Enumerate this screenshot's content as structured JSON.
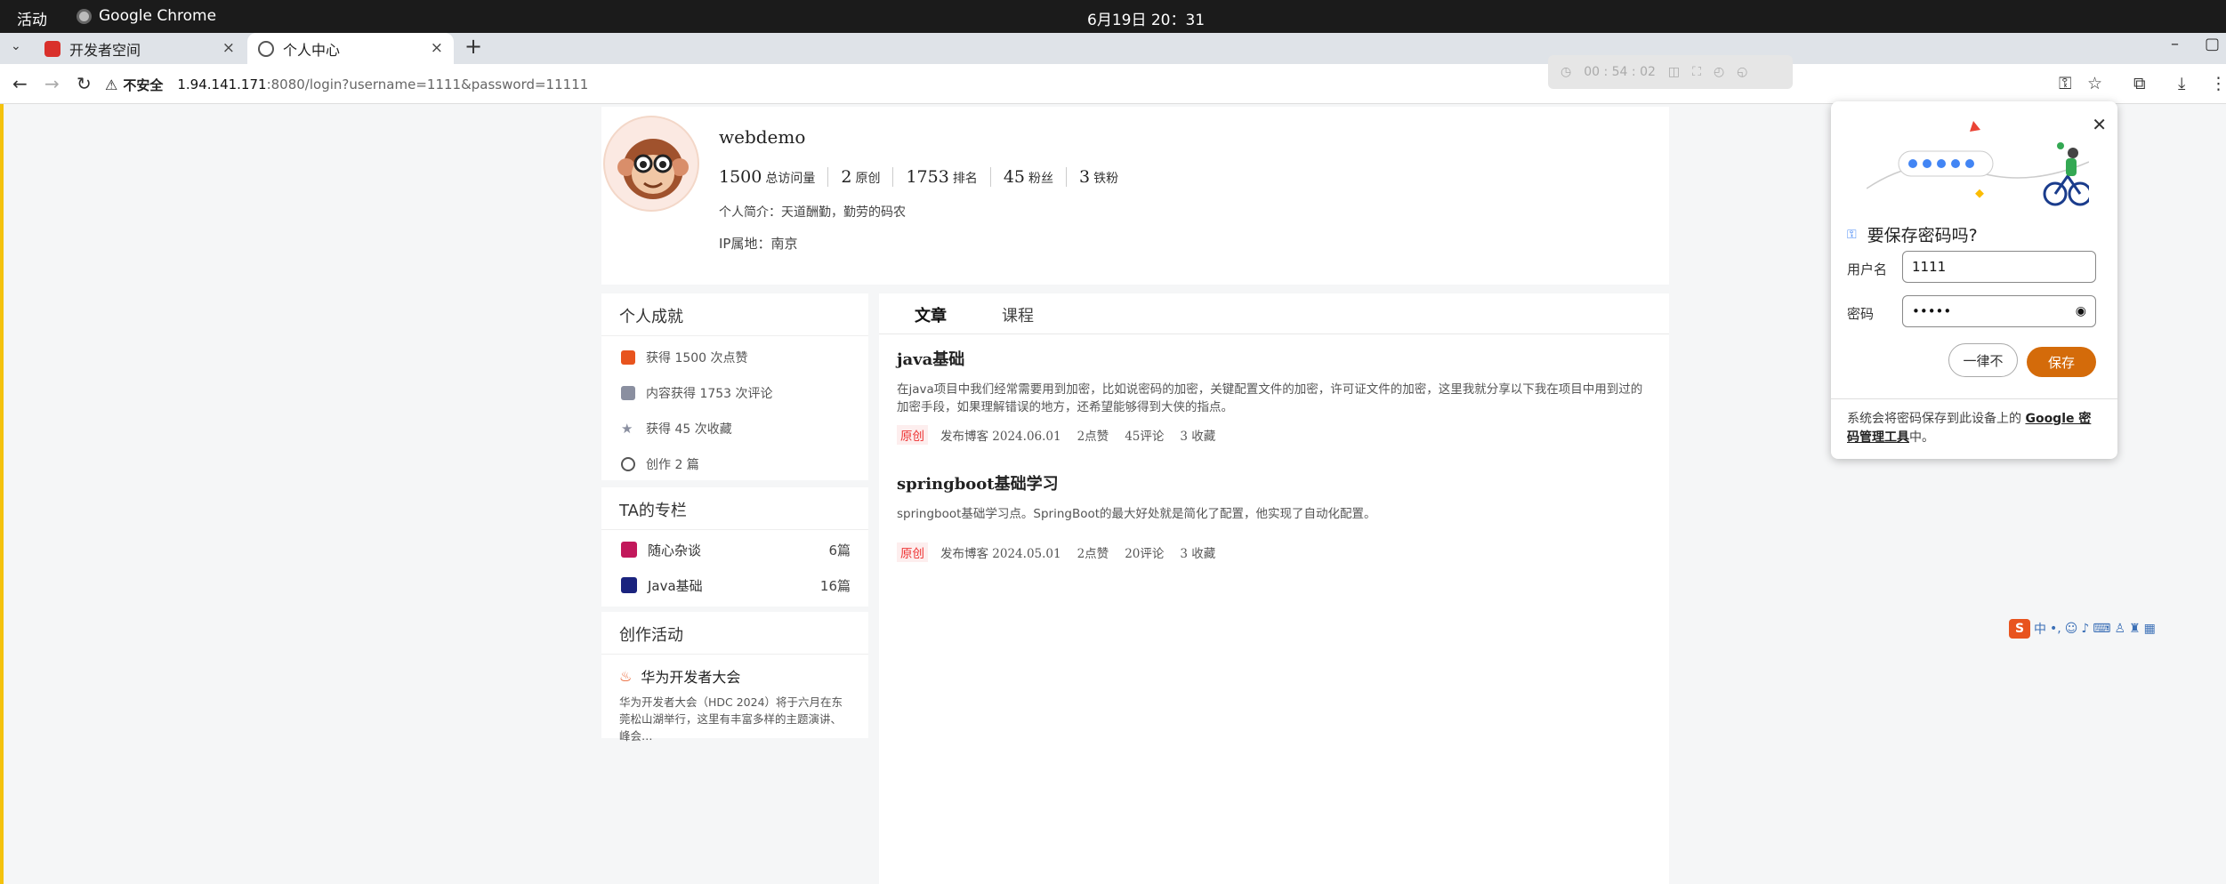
{
  "os": {
    "activities": "活动",
    "app_name": "Google Chrome",
    "clock": "6月19日  20：31"
  },
  "browser": {
    "tabs": [
      {
        "title": "开发者空间",
        "close": "×"
      },
      {
        "title": "个人中心",
        "close": "×"
      }
    ],
    "new_tab": "+",
    "insecure_label": "不安全",
    "url_host": "1.94.141.171",
    "url_path": ":8080/login?username=1111&password=11111",
    "recorder_time": "00 : 54 : 02"
  },
  "profile": {
    "name": "webdemo",
    "stats": [
      {
        "num": "1500",
        "label": "总访问量"
      },
      {
        "num": "2",
        "label": "原创"
      },
      {
        "num": "1753",
        "label": "排名"
      },
      {
        "num": "45",
        "label": "粉丝"
      },
      {
        "num": "3",
        "label": "铁粉"
      }
    ],
    "intro": "个人简介：天道酬勤，勤劳的码农",
    "ip": "IP属地：南京"
  },
  "achievements": {
    "title": "个人成就",
    "items": [
      {
        "text": "获得 1500 次点赞",
        "icon": "thumbs-up-icon"
      },
      {
        "text": "内容获得 1753 次评论",
        "icon": "comment-icon"
      },
      {
        "text": "获得 45 次收藏",
        "icon": "star-icon"
      },
      {
        "text": "创作 2 篇",
        "icon": "bulb-icon"
      }
    ]
  },
  "columns": {
    "title": "TA的专栏",
    "items": [
      {
        "name": "随心杂谈",
        "count": "6篇"
      },
      {
        "name": "Java基础",
        "count": "16篇"
      }
    ]
  },
  "activity": {
    "title": "创作活动",
    "event_title": "华为开发者大会",
    "event_desc": "华为开发者大会（HDC 2024）将于六月在东莞松山湖举行，这里有丰富多样的主题演讲、峰会…"
  },
  "main": {
    "tabs": [
      "文章",
      "课程"
    ],
    "articles": [
      {
        "title": "java基础",
        "desc": "在java项目中我们经常需要用到加密，比如说密码的加密，关键配置文件的加密，许可证文件的加密，这里我就分享以下我在项目中用到过的加密手段，如果理解错误的地方，还希望能够得到大侠的指点。",
        "badge": "原创",
        "date": "发布博客 2024.06.01",
        "likes": "2点赞",
        "comments": "45评论",
        "favs": "3 收藏"
      },
      {
        "title": "springboot基础学习",
        "desc": "springboot基础学习点。SpringBoot的最大好处就是简化了配置，他实现了自动化配置。",
        "badge": "原创",
        "date": "发布博客 2024.05.01",
        "likes": "2点赞",
        "comments": "20评论",
        "favs": "3 收藏"
      }
    ]
  },
  "password_prompt": {
    "title": "要保存密码吗?",
    "username_label": "用户名",
    "username_value": "1111",
    "password_label": "密码",
    "password_value": "•••••",
    "never_label": "一律不",
    "save_label": "保存",
    "footer_prefix": "系统会将密码保存到此设备上的 ",
    "footer_link": "Google 密码管理工具",
    "footer_suffix": "中。"
  },
  "colors": {
    "accent": "#d46b0a",
    "original_badge": "#e33333",
    "like": "#e8541e"
  }
}
